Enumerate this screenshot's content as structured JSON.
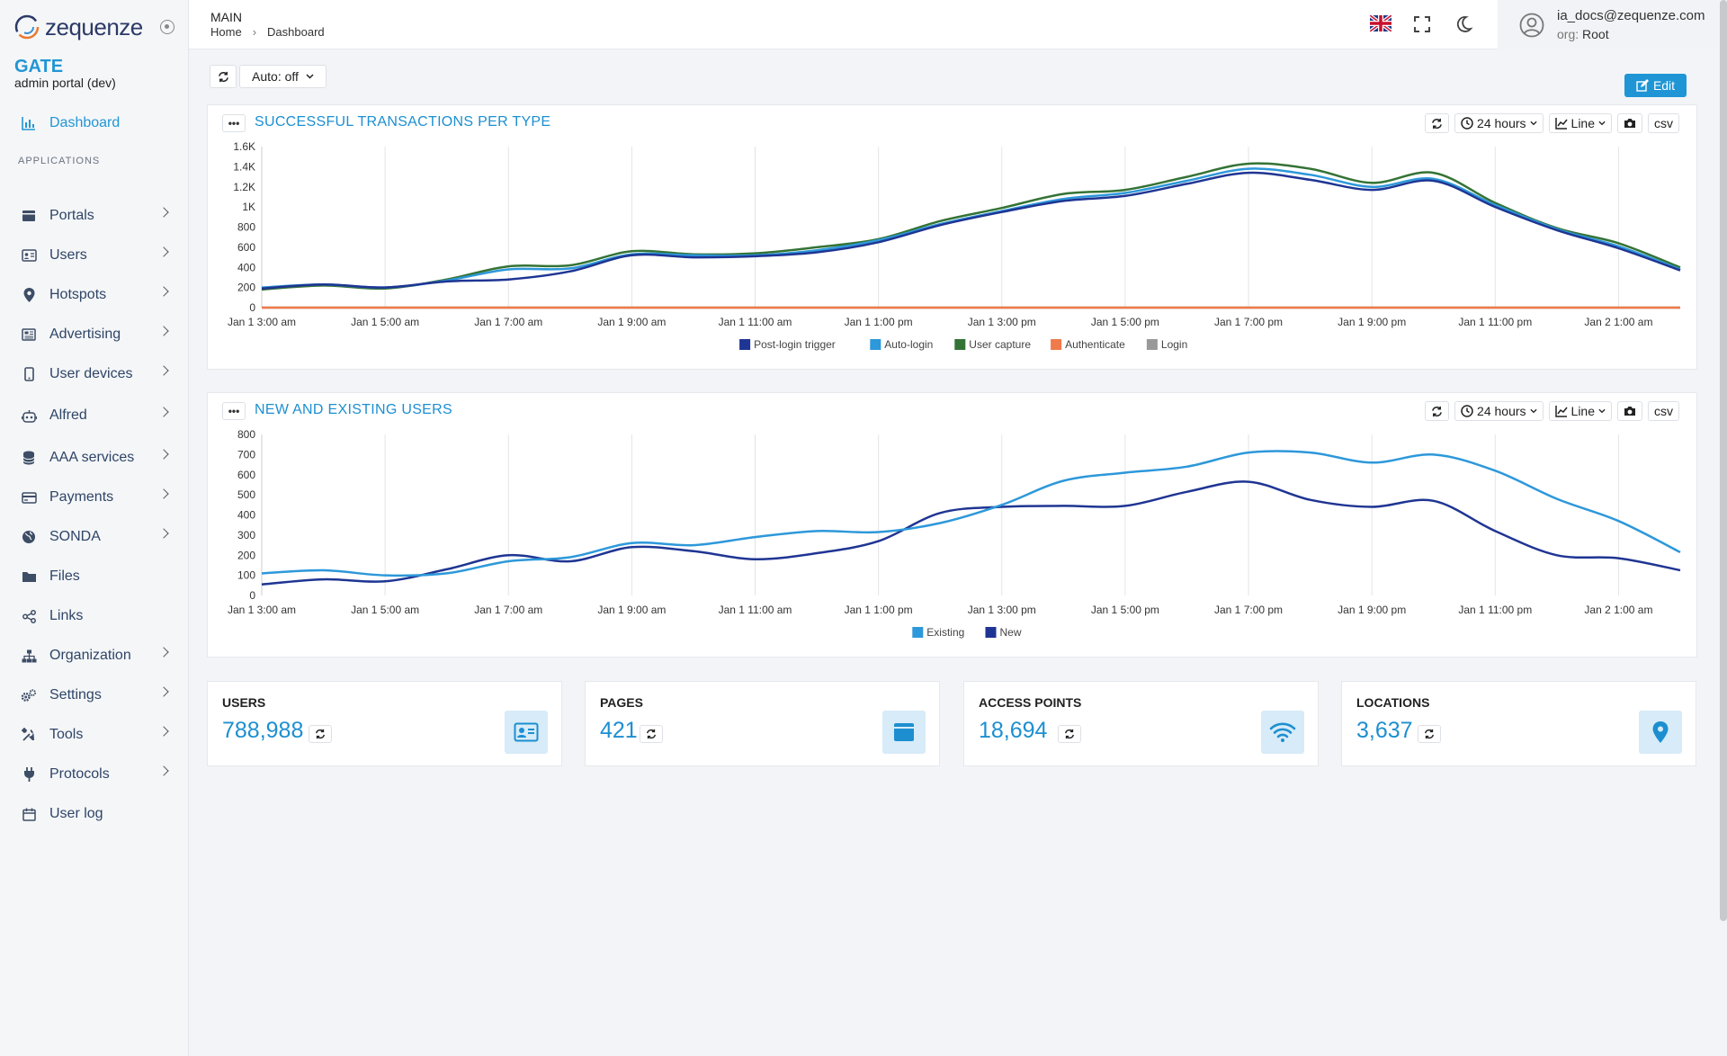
{
  "brand": {
    "logo_text": "zequenze",
    "app": "GATE",
    "subtitle": "admin portal (dev)"
  },
  "sidebar": {
    "dashboard": "Dashboard",
    "section": "APPLICATIONS",
    "items": [
      {
        "label": "Portals",
        "icon": "portal-icon"
      },
      {
        "label": "Users",
        "icon": "id-card-icon"
      },
      {
        "label": "Hotspots",
        "icon": "map-pin-icon"
      },
      {
        "label": "Advertising",
        "icon": "newspaper-icon"
      },
      {
        "label": "User devices",
        "icon": "mobile-icon"
      },
      {
        "label": "Alfred",
        "icon": "robot-icon"
      },
      {
        "label": "AAA services",
        "icon": "database-icon"
      },
      {
        "label": "Payments",
        "icon": "credit-card-icon"
      },
      {
        "label": "SONDA",
        "icon": "globe-icon"
      },
      {
        "label": "Files",
        "icon": "folder-icon"
      },
      {
        "label": "Links",
        "icon": "share-icon"
      },
      {
        "label": "Organization",
        "icon": "sitemap-icon"
      },
      {
        "label": "Settings",
        "icon": "gears-icon"
      },
      {
        "label": "Tools",
        "icon": "tools-icon"
      },
      {
        "label": "Protocols",
        "icon": "plug-icon"
      },
      {
        "label": "User log",
        "icon": "calendar-icon"
      }
    ]
  },
  "header": {
    "title": "MAIN",
    "crumb_home": "Home",
    "crumb_current": "Dashboard"
  },
  "user": {
    "email": "ia_docs@zequenze.com",
    "org_key": "org:",
    "org_value": "Root"
  },
  "toolbar": {
    "auto_label": "Auto: off",
    "edit_label": "Edit"
  },
  "chart_tools": {
    "range": "24 hours",
    "type": "Line",
    "csv": "csv"
  },
  "chart1": {
    "title": "SUCCESSFUL TRANSACTIONS PER TYPE"
  },
  "chart2": {
    "title": "NEW AND EXISTING USERS"
  },
  "stats": [
    {
      "label": "USERS",
      "value": "788,988",
      "icon": "id-card-icon"
    },
    {
      "label": "PAGES",
      "value": "421",
      "icon": "window-icon"
    },
    {
      "label": "ACCESS POINTS",
      "value": "18,694",
      "icon": "wifi-icon"
    },
    {
      "label": "LOCATIONS",
      "value": "3,637",
      "icon": "location-icon"
    }
  ],
  "chart_data": [
    {
      "type": "line",
      "title": "SUCCESSFUL TRANSACTIONS PER TYPE",
      "x": [
        "Jan 1 3:00 am",
        "Jan 1 4:00 am",
        "Jan 1 5:00 am",
        "Jan 1 6:00 am",
        "Jan 1 7:00 am",
        "Jan 1 8:00 am",
        "Jan 1 9:00 am",
        "Jan 1 10:00 am",
        "Jan 1 11:00 am",
        "Jan 1 12:00 pm",
        "Jan 1 1:00 pm",
        "Jan 1 2:00 pm",
        "Jan 1 3:00 pm",
        "Jan 1 4:00 pm",
        "Jan 1 5:00 pm",
        "Jan 1 6:00 pm",
        "Jan 1 7:00 pm",
        "Jan 1 8:00 pm",
        "Jan 1 9:00 pm",
        "Jan 1 10:00 pm",
        "Jan 1 11:00 pm",
        "Jan 2 12:00 am",
        "Jan 2 1:00 am",
        "Jan 2 2:00 am"
      ],
      "x_ticks": [
        "Jan 1 3:00 am",
        "Jan 1 5:00 am",
        "Jan 1 7:00 am",
        "Jan 1 9:00 am",
        "Jan 1 11:00 am",
        "Jan 1 1:00 pm",
        "Jan 1 3:00 pm",
        "Jan 1 5:00 pm",
        "Jan 1 7:00 pm",
        "Jan 1 9:00 pm",
        "Jan 1 11:00 pm",
        "Jan 2 1:00 am"
      ],
      "y_ticks": [
        "0",
        "200",
        "400",
        "600",
        "800",
        "1K",
        "1.2K",
        "1.4K",
        "1.6K"
      ],
      "ylim": [
        0,
        1600
      ],
      "grid": "vertical",
      "legend": "bottom",
      "series": [
        {
          "name": "Post-login trigger",
          "color": "#1f3593",
          "values": [
            190,
            230,
            200,
            260,
            280,
            360,
            520,
            500,
            510,
            550,
            650,
            820,
            950,
            1060,
            1110,
            1230,
            1340,
            1270,
            1170,
            1260,
            1000,
            770,
            590,
            370
          ]
        },
        {
          "name": "Auto-login",
          "color": "#2d98da",
          "values": [
            200,
            230,
            200,
            270,
            380,
            390,
            530,
            520,
            520,
            570,
            670,
            830,
            960,
            1080,
            1140,
            1260,
            1380,
            1320,
            1200,
            1280,
            1020,
            780,
            610,
            380
          ]
        },
        {
          "name": "User capture",
          "color": "#347335",
          "values": [
            180,
            220,
            190,
            280,
            410,
            420,
            560,
            530,
            540,
            600,
            680,
            860,
            990,
            1130,
            1170,
            1300,
            1430,
            1380,
            1240,
            1340,
            1040,
            790,
            640,
            400
          ]
        },
        {
          "name": "Authenticate",
          "color": "#f07a4b",
          "values": [
            0,
            0,
            0,
            0,
            0,
            0,
            0,
            0,
            0,
            0,
            0,
            0,
            0,
            0,
            0,
            0,
            0,
            0,
            0,
            0,
            0,
            0,
            0,
            0
          ]
        },
        {
          "name": "Login",
          "color": "#999999",
          "values": [
            0,
            0,
            0,
            0,
            0,
            0,
            0,
            0,
            0,
            0,
            0,
            0,
            0,
            0,
            0,
            0,
            0,
            0,
            0,
            0,
            0,
            0,
            0,
            0
          ]
        }
      ]
    },
    {
      "type": "line",
      "title": "NEW AND EXISTING USERS",
      "x": [
        "Jan 1 3:00 am",
        "Jan 1 4:00 am",
        "Jan 1 5:00 am",
        "Jan 1 6:00 am",
        "Jan 1 7:00 am",
        "Jan 1 8:00 am",
        "Jan 1 9:00 am",
        "Jan 1 10:00 am",
        "Jan 1 11:00 am",
        "Jan 1 12:00 pm",
        "Jan 1 1:00 pm",
        "Jan 1 2:00 pm",
        "Jan 1 3:00 pm",
        "Jan 1 4:00 pm",
        "Jan 1 5:00 pm",
        "Jan 1 6:00 pm",
        "Jan 1 7:00 pm",
        "Jan 1 8:00 pm",
        "Jan 1 9:00 pm",
        "Jan 1 10:00 pm",
        "Jan 1 11:00 pm",
        "Jan 2 12:00 am",
        "Jan 2 1:00 am",
        "Jan 2 2:00 am"
      ],
      "x_ticks": [
        "Jan 1 3:00 am",
        "Jan 1 5:00 am",
        "Jan 1 7:00 am",
        "Jan 1 9:00 am",
        "Jan 1 11:00 am",
        "Jan 1 1:00 pm",
        "Jan 1 3:00 pm",
        "Jan 1 5:00 pm",
        "Jan 1 7:00 pm",
        "Jan 1 9:00 pm",
        "Jan 1 11:00 pm",
        "Jan 2 1:00 am"
      ],
      "y_ticks": [
        "0",
        "100",
        "200",
        "300",
        "400",
        "500",
        "600",
        "700",
        "800"
      ],
      "ylim": [
        0,
        800
      ],
      "grid": "vertical",
      "legend": "bottom",
      "series": [
        {
          "name": "Existing",
          "color": "#2d98da",
          "values": [
            110,
            125,
            100,
            110,
            170,
            190,
            260,
            250,
            290,
            320,
            315,
            360,
            450,
            570,
            610,
            640,
            710,
            710,
            660,
            700,
            620,
            480,
            370,
            215
          ]
        },
        {
          "name": "New",
          "color": "#1f3593",
          "values": [
            55,
            80,
            70,
            130,
            200,
            170,
            240,
            220,
            180,
            210,
            270,
            410,
            440,
            445,
            445,
            515,
            565,
            475,
            440,
            470,
            320,
            200,
            185,
            125
          ]
        }
      ]
    }
  ]
}
